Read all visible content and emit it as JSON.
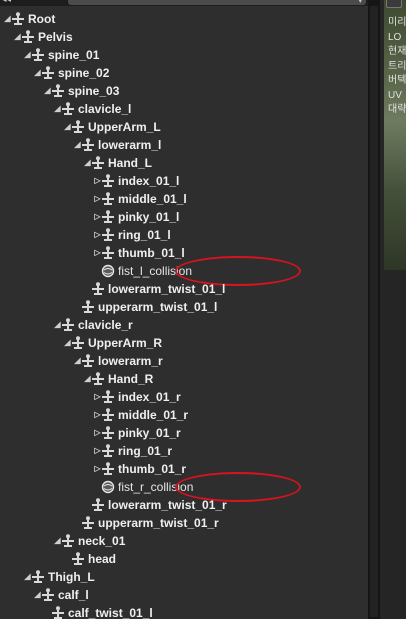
{
  "rows": [
    {
      "label": "Root",
      "depth": 0,
      "exp": "open",
      "icon": "bone"
    },
    {
      "label": "Pelvis",
      "depth": 1,
      "exp": "open",
      "icon": "bone"
    },
    {
      "label": "spine_01",
      "depth": 2,
      "exp": "open",
      "icon": "bone"
    },
    {
      "label": "spine_02",
      "depth": 3,
      "exp": "open",
      "icon": "bone"
    },
    {
      "label": "spine_03",
      "depth": 4,
      "exp": "open",
      "icon": "bone"
    },
    {
      "label": "clavicle_l",
      "depth": 5,
      "exp": "open",
      "icon": "bone"
    },
    {
      "label": "UpperArm_L",
      "depth": 6,
      "exp": "open",
      "icon": "bone"
    },
    {
      "label": "lowerarm_l",
      "depth": 7,
      "exp": "open",
      "icon": "bone"
    },
    {
      "label": "Hand_L",
      "depth": 8,
      "exp": "open",
      "icon": "bone"
    },
    {
      "label": "index_01_l",
      "depth": 9,
      "exp": "closed",
      "icon": "bone"
    },
    {
      "label": "middle_01_l",
      "depth": 9,
      "exp": "closed",
      "icon": "bone"
    },
    {
      "label": "pinky_01_l",
      "depth": 9,
      "exp": "closed",
      "icon": "bone"
    },
    {
      "label": "ring_01_l",
      "depth": 9,
      "exp": "closed",
      "icon": "bone"
    },
    {
      "label": "thumb_01_l",
      "depth": 9,
      "exp": "closed",
      "icon": "bone"
    },
    {
      "label": "fist_l_collision",
      "depth": 9,
      "exp": "none",
      "icon": "collision",
      "highlight": true
    },
    {
      "label": "lowerarm_twist_01_l",
      "depth": 8,
      "exp": "none",
      "icon": "bone"
    },
    {
      "label": "upperarm_twist_01_l",
      "depth": 7,
      "exp": "none",
      "icon": "bone"
    },
    {
      "label": "clavicle_r",
      "depth": 5,
      "exp": "open",
      "icon": "bone"
    },
    {
      "label": "UpperArm_R",
      "depth": 6,
      "exp": "open",
      "icon": "bone"
    },
    {
      "label": "lowerarm_r",
      "depth": 7,
      "exp": "open",
      "icon": "bone"
    },
    {
      "label": "Hand_R",
      "depth": 8,
      "exp": "open",
      "icon": "bone"
    },
    {
      "label": "index_01_r",
      "depth": 9,
      "exp": "closed",
      "icon": "bone"
    },
    {
      "label": "middle_01_r",
      "depth": 9,
      "exp": "closed",
      "icon": "bone"
    },
    {
      "label": "pinky_01_r",
      "depth": 9,
      "exp": "closed",
      "icon": "bone"
    },
    {
      "label": "ring_01_r",
      "depth": 9,
      "exp": "closed",
      "icon": "bone"
    },
    {
      "label": "thumb_01_r",
      "depth": 9,
      "exp": "closed",
      "icon": "bone"
    },
    {
      "label": "fist_r_collision",
      "depth": 9,
      "exp": "none",
      "icon": "collision",
      "highlight": true
    },
    {
      "label": "lowerarm_twist_01_r",
      "depth": 8,
      "exp": "none",
      "icon": "bone"
    },
    {
      "label": "upperarm_twist_01_r",
      "depth": 7,
      "exp": "none",
      "icon": "bone"
    },
    {
      "label": "neck_01",
      "depth": 5,
      "exp": "open",
      "icon": "bone"
    },
    {
      "label": "head",
      "depth": 6,
      "exp": "none",
      "icon": "bone"
    },
    {
      "label": "Thigh_L",
      "depth": 2,
      "exp": "open",
      "icon": "bone"
    },
    {
      "label": "calf_l",
      "depth": 3,
      "exp": "open",
      "icon": "bone"
    },
    {
      "label": "calf_twist_01_l",
      "depth": 4,
      "exp": "none",
      "icon": "bone"
    }
  ],
  "side_text": [
    "미리",
    "LO",
    "현재",
    "트리",
    "버텍",
    "UV",
    "대략"
  ],
  "colors": {
    "highlight": "#d4141e",
    "text": "#efefef",
    "background": "#2e2e2e"
  },
  "icons": {
    "expanded": "▲",
    "collapsed": "▷",
    "bone": "bone-icon",
    "collision": "collision-sphere-icon"
  }
}
